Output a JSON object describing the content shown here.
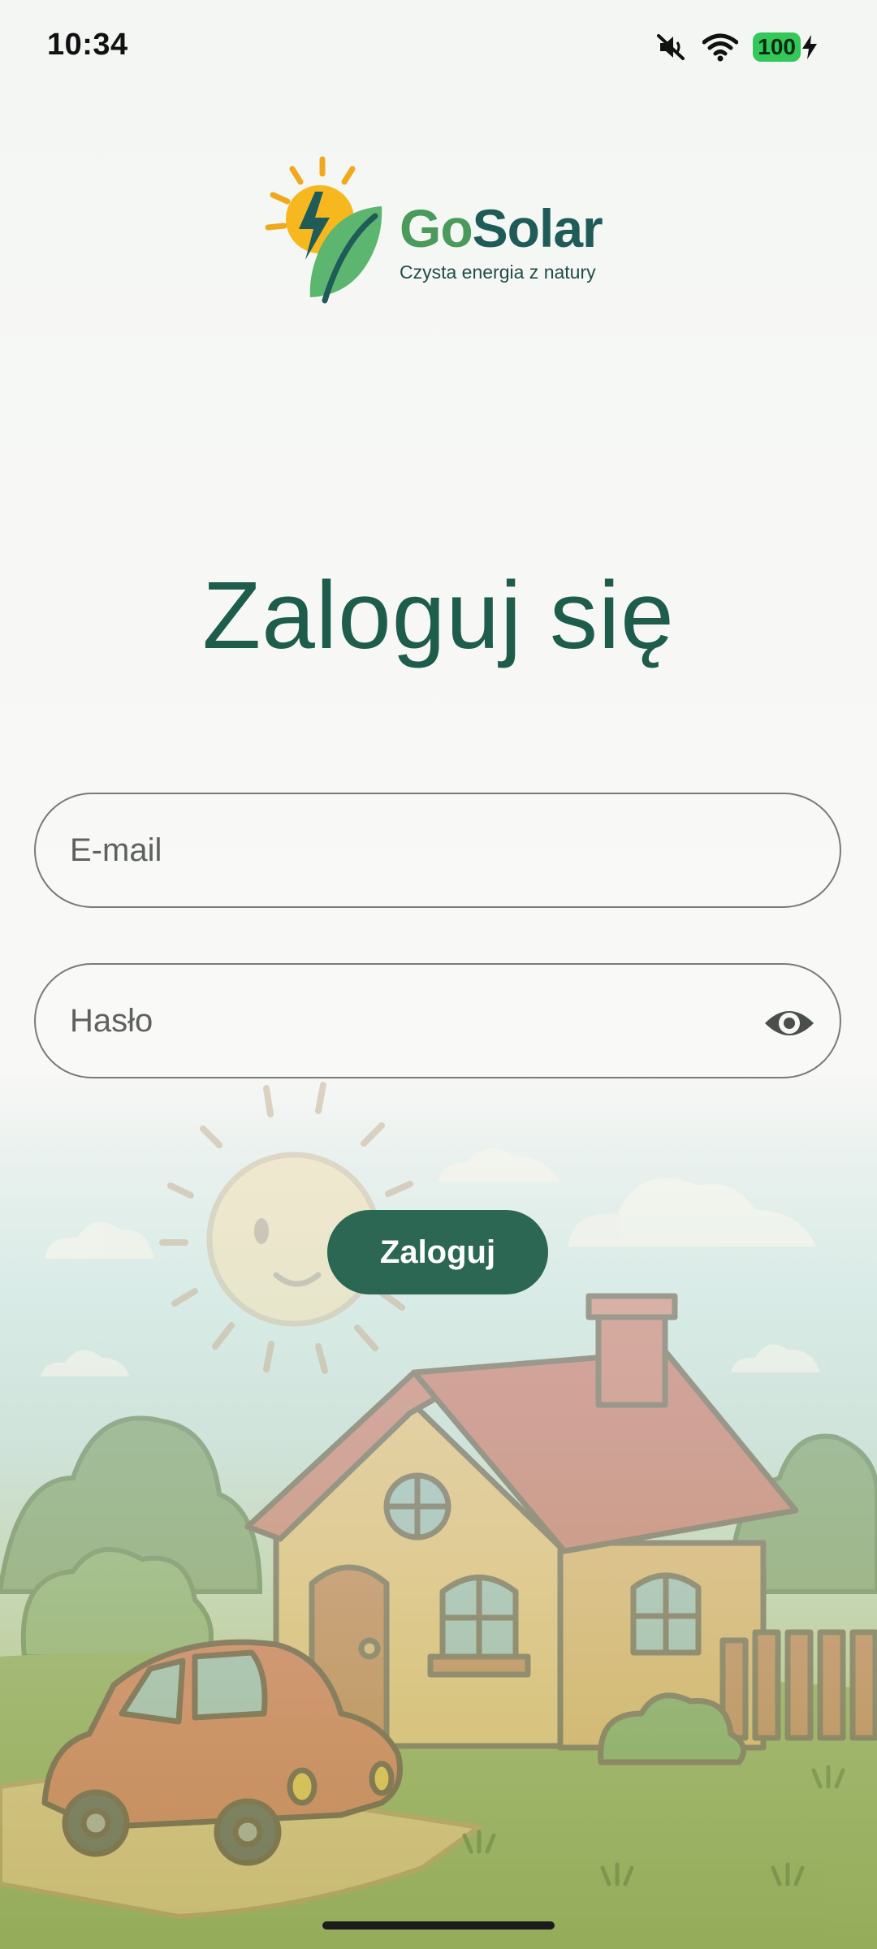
{
  "status_bar": {
    "time": "10:34",
    "battery": "100"
  },
  "logo": {
    "brand_go": "Go",
    "brand_solar": "Solar",
    "tagline": "Czysta energia z natury"
  },
  "title": "Zaloguj się",
  "email": {
    "placeholder": "E-mail",
    "value": ""
  },
  "password": {
    "placeholder": "Hasło",
    "value": ""
  },
  "login_button": "Zaloguj",
  "colors": {
    "primary": "#2b6753",
    "title": "#1e5c4c",
    "brand_green": "#4a9a5b",
    "brand_teal": "#1f5c58"
  }
}
